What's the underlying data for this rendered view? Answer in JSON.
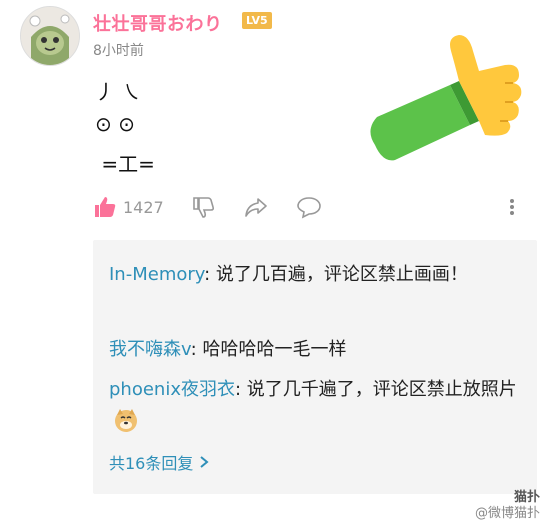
{
  "post": {
    "username": "壮壮哥哥おわり",
    "level_badge": "LV5",
    "timestamp": "8小时前",
    "lines": [
      "丿 ㇏",
      "⊙ ⊙",
      " =工="
    ]
  },
  "actions": {
    "like_count": "1427"
  },
  "replies": [
    {
      "author": "In-Memory",
      "separator": ": ",
      "text": "说了几百遍，评论区禁止画画！"
    },
    {
      "author": "我不嗨森v",
      "separator": ": ",
      "text": "哈哈哈哈一毛一样"
    },
    {
      "author": "phoenix夜羽衣",
      "separator": ": ",
      "text": "说了几千遍了，评论区禁止放照片"
    }
  ],
  "more_replies": "共16条回复",
  "watermark": {
    "top": "猫扑",
    "bottom": "@微博猫扑"
  },
  "colors": {
    "username": "#fb7299",
    "reply_author": "#2e8fb8",
    "like_icon": "#fb7299",
    "thumb_skin": "#ffc83d",
    "sleeve": "#5cc24a"
  },
  "icons": [
    "thumbs-up-icon",
    "thumbs-down-icon",
    "share-icon",
    "comment-icon",
    "more-vertical-icon",
    "chevron-right-icon",
    "doge-emoji-icon",
    "thumbs-up-emoji-icon"
  ]
}
